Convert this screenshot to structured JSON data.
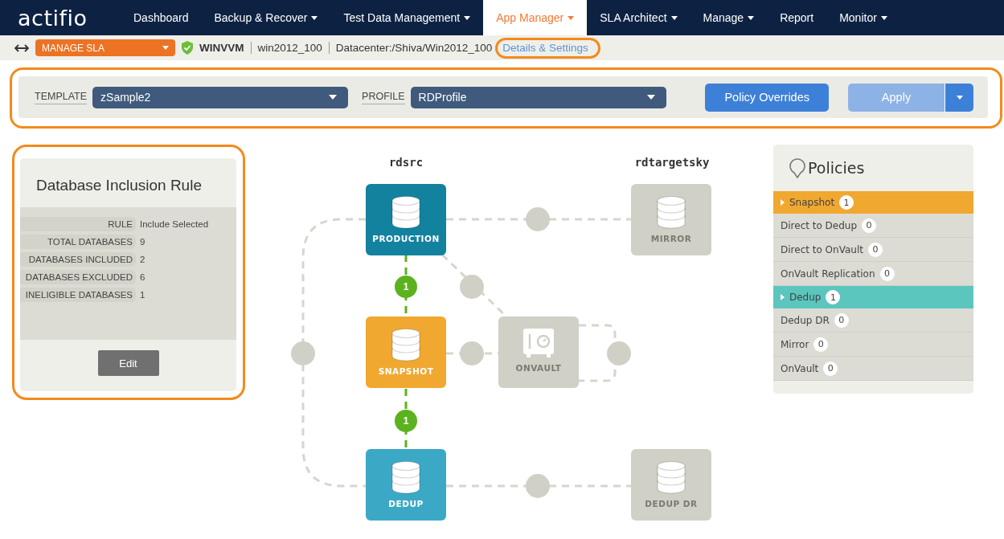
{
  "nav": {
    "logo": "actifio",
    "items": [
      {
        "label": "Dashboard",
        "dropdown": false,
        "selected": false
      },
      {
        "label": "Backup & Recover",
        "dropdown": true,
        "selected": false
      },
      {
        "label": "Test Data Management",
        "dropdown": true,
        "selected": false
      },
      {
        "label": "App Manager",
        "dropdown": true,
        "selected": true
      },
      {
        "label": "SLA Architect",
        "dropdown": true,
        "selected": false
      },
      {
        "label": "Manage",
        "dropdown": true,
        "selected": false
      },
      {
        "label": "Report",
        "dropdown": false,
        "selected": false
      },
      {
        "label": "Monitor",
        "dropdown": true,
        "selected": false
      }
    ]
  },
  "breadcrumb": {
    "mode": "MANAGE SLA",
    "host": "WINVVM",
    "app": "win2012_100",
    "path": "Datacenter:/Shiva/Win2012_100",
    "link": "Details & Settings"
  },
  "toolbar": {
    "template_label": "TEMPLATE",
    "template": "zSample2",
    "profile_label": "PROFILE",
    "profile": "RDProfile",
    "buttons": [
      {
        "label": "Policy Overrides",
        "disabled": false
      },
      {
        "label": "Apply",
        "disabled": true
      }
    ]
  },
  "rule_panel": {
    "title": "Database Inclusion Rule",
    "rows": [
      {
        "label": "RULE",
        "value": "Include Selected"
      },
      {
        "label": "TOTAL DATABASES",
        "value": "9"
      },
      {
        "label": "DATABASES INCLUDED",
        "value": "2"
      },
      {
        "label": "DATABASES EXCLUDED",
        "value": "6"
      },
      {
        "label": "INELIGIBLE DATABASES",
        "value": "1"
      }
    ],
    "button": "Edit"
  },
  "diagram": {
    "columns": [
      "rdsrc",
      "rdtargetsky"
    ],
    "nodes": [
      {
        "label": "PRODUCTION",
        "kind": "database",
        "color": "#12829f"
      },
      {
        "label": "SNAPSHOT",
        "kind": "database",
        "color": "#f0a830"
      },
      {
        "label": "DEDUP",
        "kind": "database",
        "color": "#3ba9c6"
      },
      {
        "label": "ONVAULT",
        "kind": "vault",
        "color": "#d0d0c6"
      },
      {
        "label": "MIRROR",
        "kind": "database",
        "color": "#d0d0c6"
      },
      {
        "label": "DEDUP DR",
        "kind": "database",
        "color": "#d0d0c6"
      }
    ],
    "badges": [
      "1",
      "1"
    ]
  },
  "policies": {
    "title": "Policies",
    "items": [
      {
        "kind": "group",
        "label": "Snapshot",
        "count": "1",
        "color": "#f0a830",
        "expanded": false
      },
      {
        "kind": "item",
        "label": "Direct to Dedup",
        "count": "0"
      },
      {
        "kind": "item",
        "label": "Direct to OnVault",
        "count": "0"
      },
      {
        "kind": "item",
        "label": "OnVault Replication",
        "count": "0"
      },
      {
        "kind": "group",
        "label": "Dedup",
        "count": "1",
        "color": "#5bc6be",
        "expanded": false
      },
      {
        "kind": "item",
        "label": "Dedup DR",
        "count": "0"
      },
      {
        "kind": "item",
        "label": "Mirror",
        "count": "0"
      },
      {
        "kind": "item",
        "label": "OnVault",
        "count": "0"
      }
    ]
  }
}
